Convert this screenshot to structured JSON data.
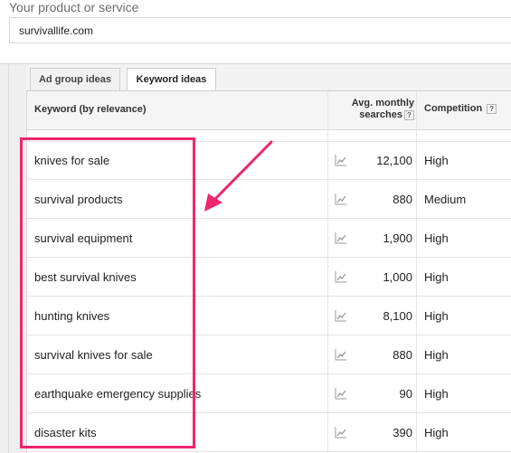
{
  "product_label": "Your product or service",
  "product_input_value": "survivallife.com",
  "tabs": [
    {
      "label": "Ad group ideas"
    },
    {
      "label": "Keyword ideas"
    }
  ],
  "table": {
    "col_keyword": "Keyword (by relevance)",
    "col_avg_line1": "Avg. monthly",
    "col_avg_line2": "searches",
    "col_competition": "Competition",
    "help_glyph": "?",
    "rows": [
      {
        "keyword": "knives for sale",
        "avg": "12,100",
        "competition": "High"
      },
      {
        "keyword": "survival products",
        "avg": "880",
        "competition": "Medium"
      },
      {
        "keyword": "survival equipment",
        "avg": "1,900",
        "competition": "High"
      },
      {
        "keyword": "best survival knives",
        "avg": "1,000",
        "competition": "High"
      },
      {
        "keyword": "hunting knives",
        "avg": "8,100",
        "competition": "High"
      },
      {
        "keyword": "survival knives for sale",
        "avg": "880",
        "competition": "High"
      },
      {
        "keyword": "earthquake emergency supplies",
        "avg": "90",
        "competition": "High"
      },
      {
        "keyword": "disaster kits",
        "avg": "390",
        "competition": "High"
      }
    ]
  },
  "annotation": {
    "color": "#f0266f",
    "icon": "trend-chart-icon"
  }
}
